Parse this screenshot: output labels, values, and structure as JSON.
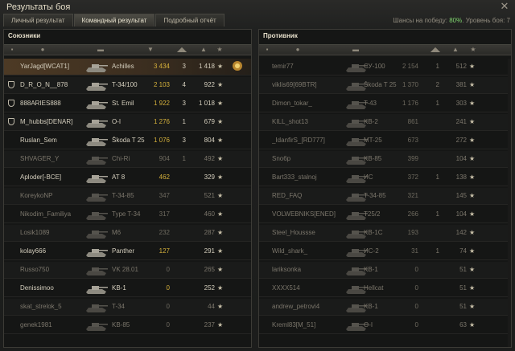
{
  "window": {
    "title": "Результаты боя",
    "close_glyph": "✕"
  },
  "tabs": [
    {
      "label": "Личный результат",
      "active": false
    },
    {
      "label": "Командный результат",
      "active": true
    },
    {
      "label": "Подробный отчёт",
      "active": false
    }
  ],
  "chance": {
    "prefix": "Шансы на победу: ",
    "pct": "80%",
    "level": ". Уровень боя: 7"
  },
  "teams": {
    "allies": {
      "name": "Союзники",
      "header_icons": [
        "platoon-icon",
        "player-icon",
        "sort-arrow-icon",
        "tank-icon",
        "damage-icon",
        "kills-icon",
        "experience-icon"
      ],
      "rows": [
        {
          "platoon": false,
          "name": "YarJagd[WCAT1]",
          "tank": "Achilles",
          "damage": "3 434",
          "kills": "3",
          "xp": "1 418",
          "alive": true,
          "me": true,
          "medal": true
        },
        {
          "platoon": true,
          "name": "D_R_O_N__878",
          "tank": "T-34/100",
          "damage": "2 103",
          "kills": "4",
          "xp": "922",
          "alive": true
        },
        {
          "platoon": true,
          "name": "888ARIES888",
          "tank": "St. Emil",
          "damage": "1 922",
          "kills": "3",
          "xp": "1 018",
          "alive": true
        },
        {
          "platoon": true,
          "name": "M_hubbs[DENAR]",
          "tank": "O-I",
          "damage": "1 276",
          "kills": "1",
          "xp": "679",
          "alive": true
        },
        {
          "platoon": false,
          "name": "Ruslan_Sem",
          "tank": "Škoda T 25",
          "damage": "1 076",
          "kills": "3",
          "xp": "804",
          "alive": true
        },
        {
          "platoon": false,
          "name": "SHVAGER_Y",
          "tank": "Chi-Ri",
          "damage": "904",
          "kills": "1",
          "xp": "492",
          "alive": false
        },
        {
          "platoon": false,
          "name": "Aploder[-BCE]",
          "tank": "AT 8",
          "damage": "462",
          "kills": "",
          "xp": "329",
          "alive": true
        },
        {
          "platoon": false,
          "name": "KoreykoNP",
          "tank": "T-34-85",
          "damage": "347",
          "kills": "",
          "xp": "521",
          "alive": false
        },
        {
          "platoon": false,
          "name": "Nikodim_Familiya",
          "tank": "Type T-34",
          "damage": "317",
          "kills": "",
          "xp": "460",
          "alive": false
        },
        {
          "platoon": false,
          "name": "Losik1089",
          "tank": "M6",
          "damage": "232",
          "kills": "",
          "xp": "287",
          "alive": false
        },
        {
          "platoon": false,
          "name": "kolay666",
          "tank": "Panther",
          "damage": "127",
          "kills": "",
          "xp": "291",
          "alive": true
        },
        {
          "platoon": false,
          "name": "Russo750",
          "tank": "VK 28.01",
          "damage": "0",
          "kills": "",
          "xp": "265",
          "alive": false
        },
        {
          "platoon": false,
          "name": "Denissimoo",
          "tank": "KB-1",
          "damage": "0",
          "kills": "",
          "xp": "252",
          "alive": true
        },
        {
          "platoon": false,
          "name": "skat_strelok_5",
          "tank": "T-34",
          "damage": "0",
          "kills": "",
          "xp": "44",
          "alive": false
        },
        {
          "platoon": false,
          "name": "genek1981",
          "tank": "KB-85",
          "damage": "0",
          "kills": "",
          "xp": "237",
          "alive": false
        }
      ]
    },
    "enemies": {
      "name": "Противник",
      "header_icons": [
        "platoon-icon",
        "player-icon",
        "tank-icon",
        "damage-icon",
        "kills-icon",
        "experience-icon"
      ],
      "rows": [
        {
          "platoon": false,
          "name": "temir77",
          "tank": "СУ-100",
          "damage": "2 154",
          "kills": "1",
          "xp": "512",
          "alive": false
        },
        {
          "platoon": false,
          "name": "viklis69[69BTR]",
          "tank": "Škoda T 25",
          "damage": "1 370",
          "kills": "2",
          "xp": "381",
          "alive": false
        },
        {
          "platoon": false,
          "name": "Dimon_tokar_",
          "tank": "T-43",
          "damage": "1 176",
          "kills": "1",
          "xp": "303",
          "alive": false
        },
        {
          "platoon": false,
          "name": "KILL_shot13",
          "tank": "KB-2",
          "damage": "861",
          "kills": "",
          "xp": "241",
          "alive": false
        },
        {
          "platoon": false,
          "name": "_IdanfirS_[RD777]",
          "tank": "MT-25",
          "damage": "673",
          "kills": "",
          "xp": "272",
          "alive": false
        },
        {
          "platoon": false,
          "name": "Sno6p",
          "tank": "KB-85",
          "damage": "399",
          "kills": "",
          "xp": "104",
          "alive": false
        },
        {
          "platoon": false,
          "name": "Bart333_stalnoj",
          "tank": "ИС",
          "damage": "372",
          "kills": "1",
          "xp": "138",
          "alive": false
        },
        {
          "platoon": false,
          "name": "RED_FAQ",
          "tank": "T-34-85",
          "damage": "321",
          "kills": "",
          "xp": "145",
          "alive": false
        },
        {
          "platoon": false,
          "name": "VOLWEBNIKS[ENED]",
          "tank": "T25/2",
          "damage": "266",
          "kills": "1",
          "xp": "104",
          "alive": false
        },
        {
          "platoon": false,
          "name": "Steel_Houssse",
          "tank": "KB-1C",
          "damage": "193",
          "kills": "",
          "xp": "142",
          "alive": false
        },
        {
          "platoon": false,
          "name": "Wild_shark_",
          "tank": "ИС-2",
          "damage": "31",
          "kills": "1",
          "xp": "74",
          "alive": false
        },
        {
          "platoon": false,
          "name": "lariksonka",
          "tank": "KB-1",
          "damage": "0",
          "kills": "",
          "xp": "51",
          "alive": false
        },
        {
          "platoon": false,
          "name": "XXXX514",
          "tank": "Hellcat",
          "damage": "0",
          "kills": "",
          "xp": "51",
          "alive": false
        },
        {
          "platoon": false,
          "name": "andrew_petrovi4",
          "tank": "KB-1",
          "damage": "0",
          "kills": "",
          "xp": "51",
          "alive": false
        },
        {
          "platoon": false,
          "name": "Kreml83[M_51]",
          "tank": "O-I",
          "damage": "0",
          "kills": "",
          "xp": "63",
          "alive": false
        }
      ]
    }
  },
  "colors": {
    "accent_green": "#7fd36e",
    "damage_gold": "#d4b03b",
    "me_row": "#4d3a25"
  }
}
